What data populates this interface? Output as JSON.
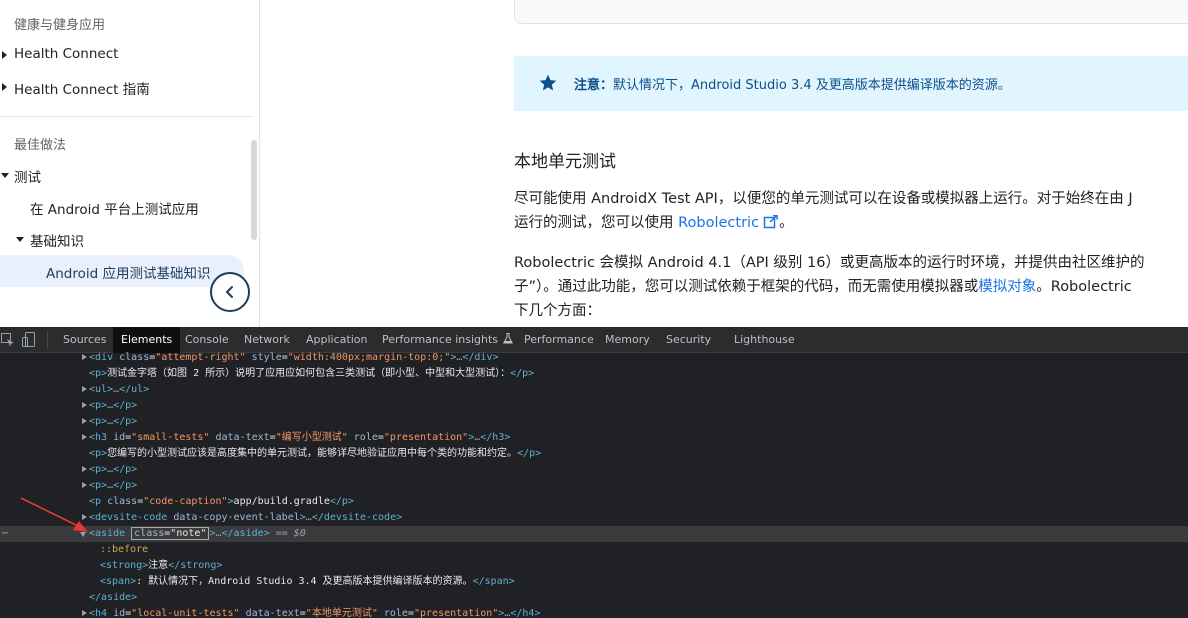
{
  "sidebar": {
    "section_health": "健康与健身应用",
    "item_health_connect": "Health Connect",
    "item_health_connect_guide": "Health Connect 指南",
    "section_best_practices": "最佳做法",
    "item_testing": "测试",
    "item_test_on_android": "在 Android 平台上测试应用",
    "item_fundamentals": "基础知识",
    "item_active": "Android 应用测试基础知识",
    "collapse_icon": "chevron-left-icon"
  },
  "content": {
    "note_label": "注意：",
    "note_text": "默认情况下，Android Studio 3.4 及更高版本提供编译版本的资源。",
    "heading_local": "本地单元测试",
    "p1_line1": "尽可能使用 AndroidX Test API，以便您的单元测试可以在设备或模拟器上运行。对于始终在由 J",
    "p1_line2_a": "运行的测试，您可以使用 ",
    "p1_link": "Robolectric",
    "p1_line2_b": "。",
    "p2_line1": "Robolectric 会模拟 Android 4.1（API 级别 16）或更高版本的运行时环境，并提供由社区维护的",
    "p2_line2_a": "子”）。通过此功能，您可以测试依赖于框架的代码，而无需使用模拟器或",
    "p2_link": "模拟对象",
    "p2_line2_b": "。Robolectric",
    "p2_line3": "下几个方面："
  },
  "devtools": {
    "tabs": [
      "Sources",
      "Elements",
      "Console",
      "Network",
      "Application",
      "Performance insights",
      "Performance",
      "Memory",
      "Security",
      "Lighthouse"
    ],
    "active_tab": "Elements",
    "dom": {
      "l1_tag": "div",
      "l1_attr1": "class",
      "l1_val1": "\"attempt-right\"",
      "l1_attr2": "style",
      "l1_val2": "\"width:400px;margin-top:0;\"",
      "l2_text": "测试金字塔（如图 2 所示）说明了应用应如何包含三类测试（即小型、中型和大型测试）：",
      "l6_attr1": "id",
      "l6_val1": "\"small-tests\"",
      "l6_attr2": "data-text",
      "l6_val2": "\"编写小型测试\"",
      "l6_attr3": "role",
      "l6_val3": "\"presentation\"",
      "l7_text": "您编写的小型测试应该是高度集中的单元测试，能够详尽地验证应用中每个类的功能和约定。",
      "l10_attr": "class",
      "l10_val": "\"code-caption\"",
      "l10_text": "app/build.gradle",
      "l11_attr": "data-copy-event-label",
      "l12_attr": "class",
      "l12_val": "\"note\"",
      "l12_eq": "== $0",
      "l13_pseudo": "::before",
      "l14_text": "注意",
      "l15_text": "默认情况下，Android Studio 3.4 及更高版本提供编译版本的资源。",
      "l17_attr1": "id",
      "l17_val1": "\"local-unit-tests\"",
      "l17_attr2": "data-text",
      "l17_val2": "\"本地单元测试\"",
      "l17_attr3": "role",
      "l17_val3": "\"presentation\""
    }
  },
  "colors": {
    "accent": "#1a73e8",
    "note_bg": "#e1f5fe",
    "devtools_bg": "#202124",
    "annotation_arrow": "#e53935"
  }
}
